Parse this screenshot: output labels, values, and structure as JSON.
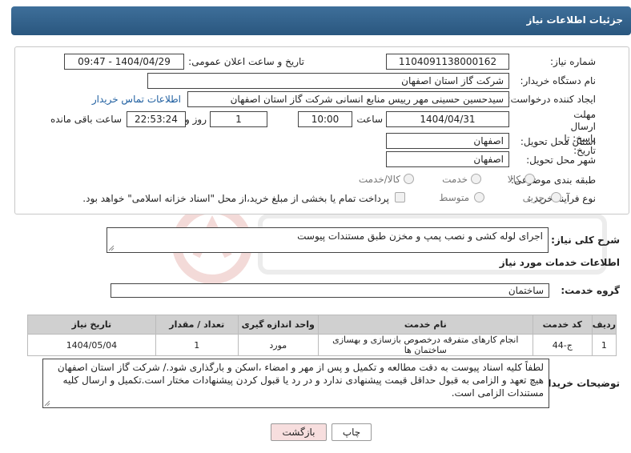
{
  "header": {
    "title": "جزئیات اطلاعات نیاز"
  },
  "form": {
    "need_number_label": "شماره نیاز:",
    "need_number": "1104091138000162",
    "announce_label": "تاریخ و ساعت اعلان عمومی:",
    "announce_value": "1404/04/29 - 09:47",
    "buyer_org_label": "نام دستگاه خریدار:",
    "buyer_org": "شرکت گاز استان اصفهان",
    "requester_label": "ایجاد کننده درخواست:",
    "requester": "سیدحسین حسینی مهر رییس منابع انسانی شرکت گاز استان اصفهان",
    "buyer_contact_link": "اطلاعات تماس خریدار",
    "deadline_label": "مهلت ارسال پاسخ: تا تاریخ:",
    "deadline_date": "1404/04/31",
    "time_label": "ساعت",
    "deadline_time": "10:00",
    "days_value": "1",
    "days_label": "روز و",
    "remaining_time": "22:53:24",
    "remaining_label": "ساعت باقی مانده",
    "province_label": "استان محل تحویل:",
    "province": "اصفهان",
    "city_label": "شهر محل تحویل:",
    "city": "اصفهان",
    "category_label": "طبقه بندی موضوعی:",
    "category_options": [
      "کالا",
      "خدمت",
      "کالا/خدمت"
    ],
    "process_label": "نوع فرآیند خرید :",
    "process_options": [
      "جزیی",
      "متوسط"
    ],
    "payment_note": "پرداخت تمام یا بخشی از مبلغ خرید،از محل \"اسناد خزانه اسلامی\" خواهد بود."
  },
  "summary": {
    "label": "شرح کلی نیاز:",
    "text": "اجرای لوله کشی و نصب پمپ و مخزن طبق مستندات پیوست"
  },
  "services": {
    "section_title": "اطلاعات خدمات مورد نیاز",
    "group_label": "گروه خدمت:",
    "group_value": "ساختمان",
    "columns": [
      "ردیف",
      "کد خدمت",
      "نام خدمت",
      "واحد اندازه گیری",
      "تعداد / مقدار",
      "تاریخ نیاز"
    ],
    "rows": [
      [
        "1",
        "ج-44",
        "انجام کارهای متفرقه درخصوص بازسازی و بهسازی ساختمان ها",
        "مورد",
        "1",
        "1404/05/04"
      ]
    ]
  },
  "notes": {
    "label": "توضیحات خریدار:",
    "text": "لطفاً کلیه اسناد پیوست به دقت مطالعه و تکمیل و  پس از مهر و امضاء ،اسکن و بارگذاری شود./  شرکت گاز  استان اصفهان هیچ تعهد و الزامی به قبول حداقل قیمت پیشنهادی ندارد و در رد یا قبول کردن پیشنهادات مختار است.تکمیل و ارسال کلیه مستندات الزامی است."
  },
  "buttons": {
    "print": "چاپ",
    "back": "بازگشت"
  },
  "colors": {
    "header": "#2f5f8a",
    "link": "#1f5fa0",
    "back_button": "#f7dede"
  }
}
